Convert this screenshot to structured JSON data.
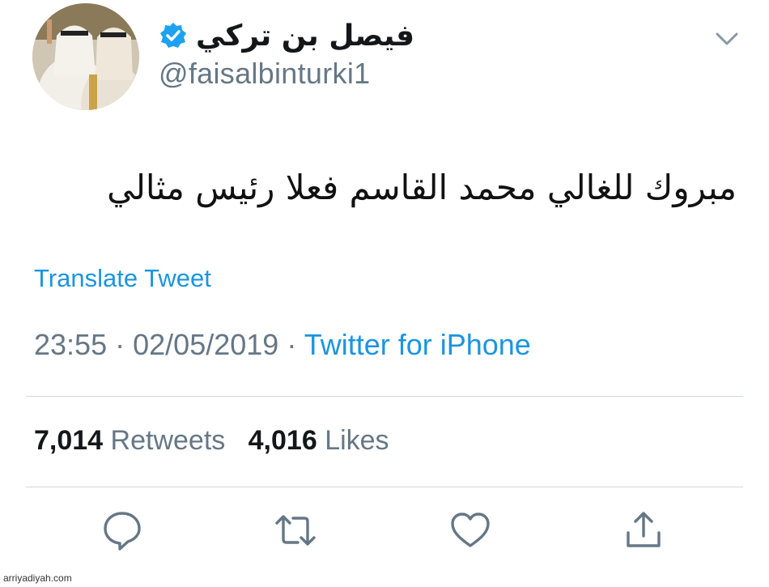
{
  "author": {
    "display_name": "فيصل بن تركي",
    "handle": "@faisalbinturki1",
    "verified": true
  },
  "tweet": {
    "text": "مبروك للغالي محمد القاسم فعلا رئيس مثالي",
    "translate_label": "Translate Tweet",
    "time": "23:55",
    "separator": "·",
    "date": "02/05/2019",
    "source": "Twitter for iPhone"
  },
  "stats": {
    "retweets_count": "7,014",
    "retweets_label": "Retweets",
    "likes_count": "4,016",
    "likes_label": "Likes"
  },
  "actions": [
    "reply-icon",
    "retweet-icon",
    "like-icon",
    "share-icon"
  ],
  "watermark": "arriyadiyah.com",
  "colors": {
    "link": "#1b95e0",
    "secondary_text": "#657786",
    "primary_text": "#14171a",
    "divider": "#d3d8dc"
  }
}
